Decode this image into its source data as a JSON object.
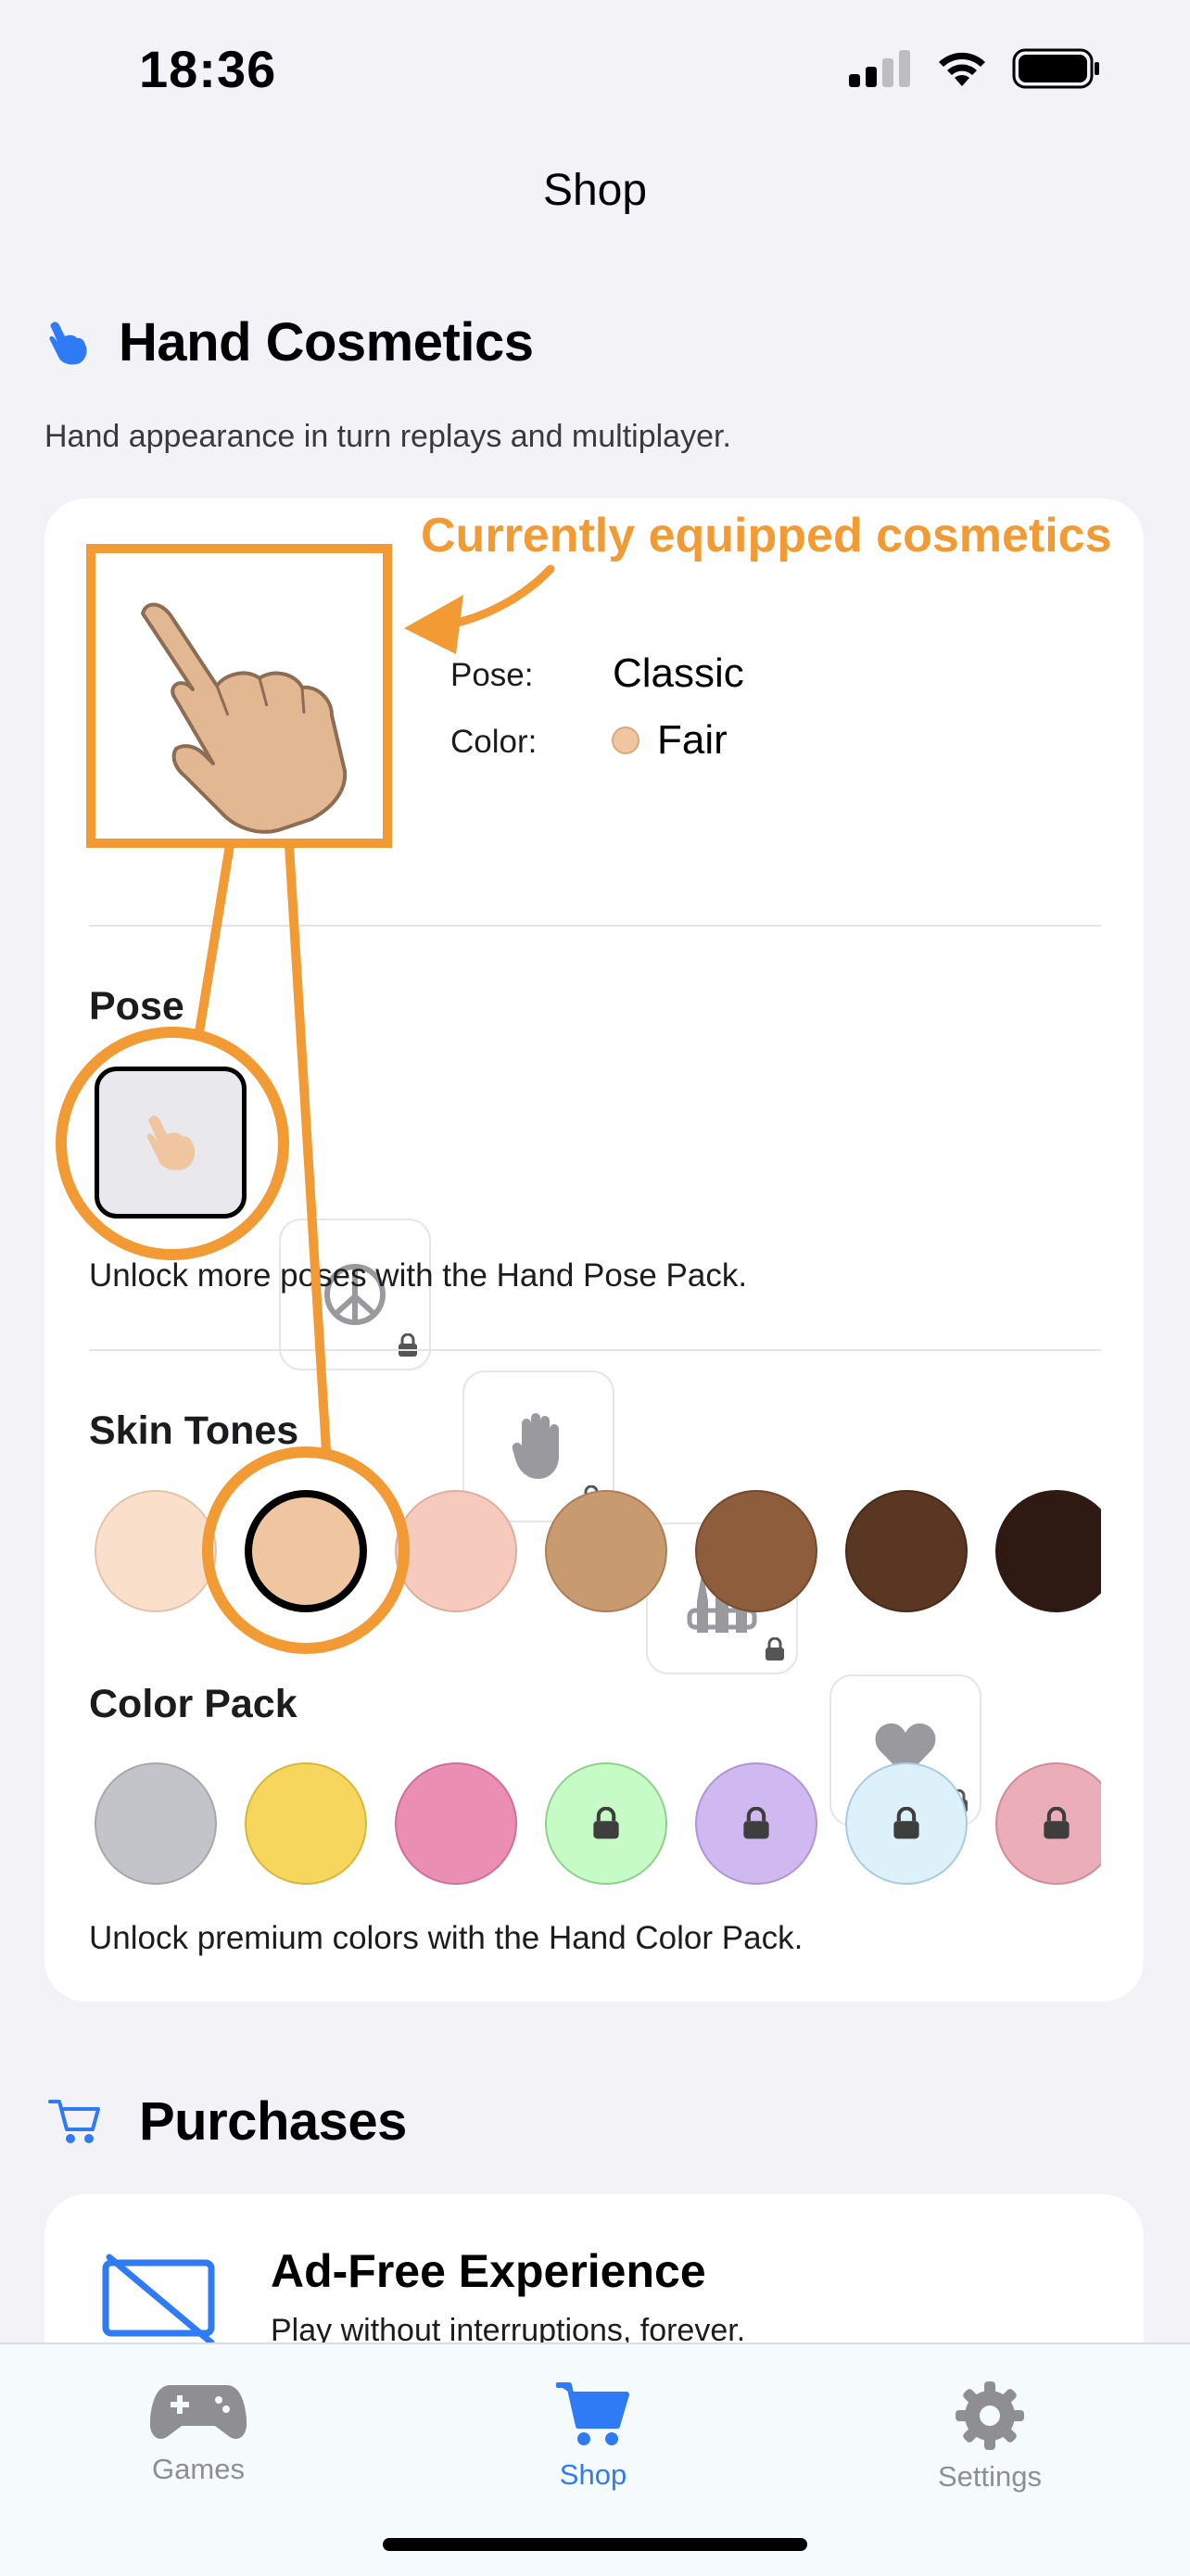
{
  "status_bar": {
    "time": "18:36"
  },
  "nav": {
    "title": "Shop"
  },
  "hand_cosmetics": {
    "title": "Hand Cosmetics",
    "subtitle": "Hand appearance in turn replays and multiplayer.",
    "annotation": "Currently equipped cosmetics",
    "equipped": {
      "pose_label": "Pose:",
      "pose_value": "Classic",
      "color_label": "Color:",
      "color_value": "Fair",
      "color_hex": "#F0C6A0"
    },
    "pose": {
      "title": "Pose",
      "hint": "Unlock more poses with the Hand Pose Pack.",
      "items": [
        {
          "icon": "pointing-hand-icon",
          "selected": true,
          "locked": false
        },
        {
          "icon": "peace-icon",
          "selected": false,
          "locked": true
        },
        {
          "icon": "raised-hand-icon",
          "selected": false,
          "locked": true
        },
        {
          "icon": "rock-hand-icon",
          "selected": false,
          "locked": true
        },
        {
          "icon": "heart-icon",
          "selected": false,
          "locked": true
        }
      ]
    },
    "skin_tones": {
      "title": "Skin Tones",
      "colors": [
        "#FAE0CA",
        "#F0C6A0",
        "#F6CABC",
        "#C89A70",
        "#8E5D3C",
        "#5A3722",
        "#2E1A12"
      ],
      "selected_index": 1
    },
    "color_pack": {
      "title": "Color Pack",
      "hint": "Unlock premium colors with the Hand Color Pack.",
      "colors": [
        "#C3C4C9",
        "#F6D65C",
        "#EB8EB4",
        "#C6FBC6",
        "#D0B9F0",
        "#DDF1FB",
        "#EBAEB9"
      ],
      "locked": [
        false,
        false,
        false,
        true,
        true,
        true,
        true
      ]
    }
  },
  "purchases": {
    "title": "Purchases",
    "item_title": "Ad-Free Experience",
    "item_subtitle": "Play without interruptions, forever."
  },
  "tab_bar": {
    "tabs": [
      {
        "label": "Games",
        "icon": "gamepad-icon",
        "active": false
      },
      {
        "label": "Shop",
        "icon": "cart-icon",
        "active": true
      },
      {
        "label": "Settings",
        "icon": "gear-icon",
        "active": false
      }
    ]
  },
  "colors": {
    "accent": "#2F7BF6",
    "annotation": "#F29A33",
    "inactive_tab": "#8E8E93"
  }
}
